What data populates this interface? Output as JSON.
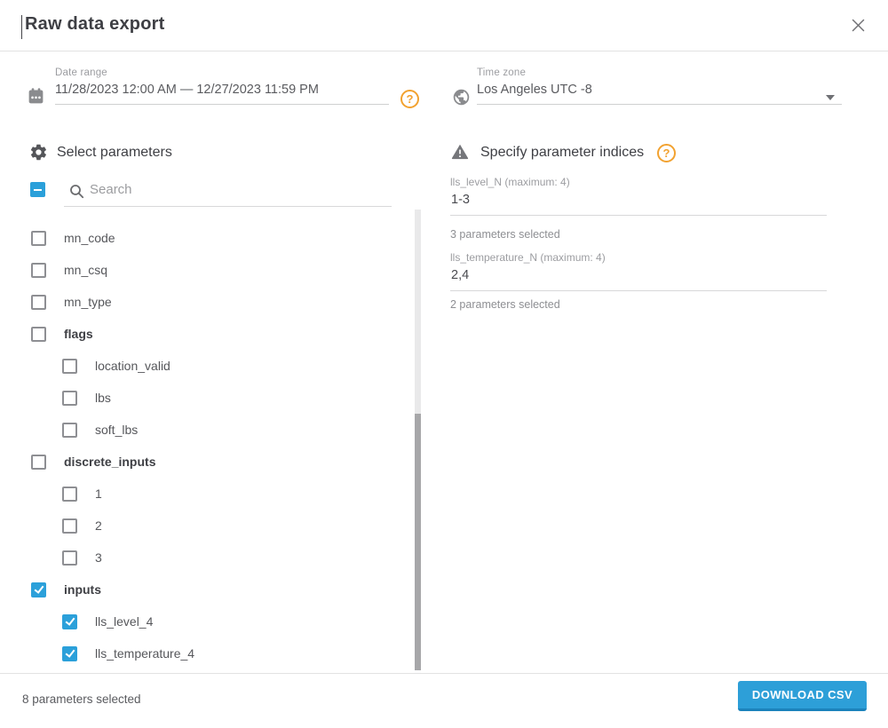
{
  "modal": {
    "title": "Raw data export"
  },
  "date_range": {
    "label": "Date range",
    "value": "11/28/2023 12:00 AM — 12/27/2023 11:59 PM",
    "help_symbol": "?"
  },
  "time_zone": {
    "label": "Time zone",
    "value": "Los Angeles UTC -8"
  },
  "parameters": {
    "title": "Select parameters",
    "search_placeholder": "Search",
    "items": [
      {
        "label": "mn_code",
        "level": 0,
        "checked": false,
        "group": false
      },
      {
        "label": "mn_csq",
        "level": 0,
        "checked": false,
        "group": false
      },
      {
        "label": "mn_type",
        "level": 0,
        "checked": false,
        "group": false
      },
      {
        "label": "flags",
        "level": 0,
        "checked": false,
        "group": true
      },
      {
        "label": "location_valid",
        "level": 1,
        "checked": false,
        "group": false
      },
      {
        "label": "lbs",
        "level": 1,
        "checked": false,
        "group": false
      },
      {
        "label": "soft_lbs",
        "level": 1,
        "checked": false,
        "group": false
      },
      {
        "label": "discrete_inputs",
        "level": 0,
        "checked": false,
        "group": true
      },
      {
        "label": "1",
        "level": 1,
        "checked": false,
        "group": false
      },
      {
        "label": "2",
        "level": 1,
        "checked": false,
        "group": false
      },
      {
        "label": "3",
        "level": 1,
        "checked": false,
        "group": false
      },
      {
        "label": "inputs",
        "level": 0,
        "checked": true,
        "group": true
      },
      {
        "label": "lls_level_4",
        "level": 1,
        "checked": true,
        "group": false
      },
      {
        "label": "lls_temperature_4",
        "level": 1,
        "checked": true,
        "group": false
      }
    ]
  },
  "indices": {
    "title": "Specify parameter indices",
    "help_symbol": "?",
    "fields": [
      {
        "label": "lls_level_N (maximum: 4)",
        "value": "1-3",
        "status": "3 parameters selected"
      },
      {
        "label": "lls_temperature_N (maximum: 4)",
        "value": "2,4",
        "status": "2 parameters selected"
      }
    ]
  },
  "footer": {
    "status": "8 parameters selected",
    "download_label": "DOWNLOAD CSV"
  },
  "colors": {
    "accent_blue": "#2ba0da",
    "button_blue": "#2d9fd8",
    "help_orange": "#f2a230"
  }
}
